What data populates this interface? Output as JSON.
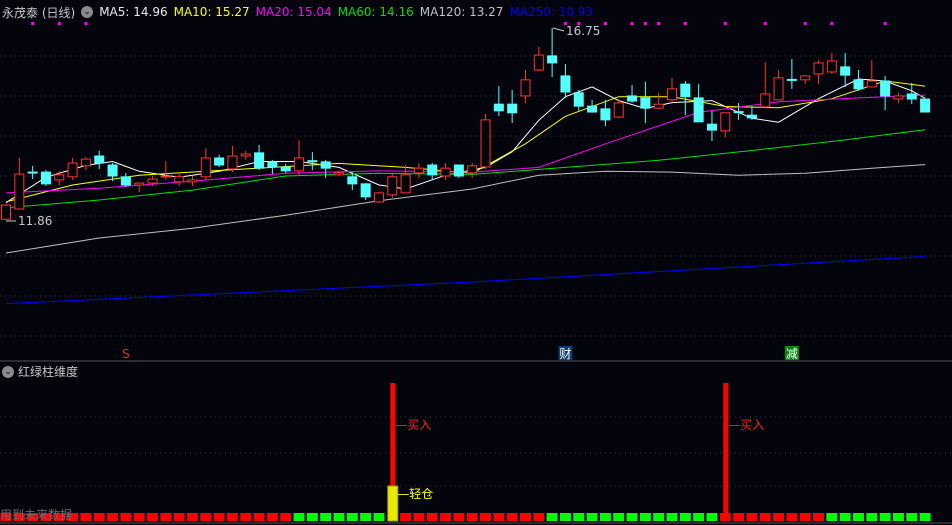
{
  "header": {
    "stock_title": "永茂泰 (日线)",
    "ma": [
      {
        "label": "MA5: 14.96",
        "color": "#e8e8e8"
      },
      {
        "label": "MA10: 15.27",
        "color": "#ffff00"
      },
      {
        "label": "MA20: 15.04",
        "color": "#ff00ff"
      },
      {
        "label": "MA60: 14.16",
        "color": "#00e000"
      },
      {
        "label": "MA120: 13.27",
        "color": "#c0c0c0"
      },
      {
        "label": "MA250: 10.93",
        "color": "#0000ff"
      }
    ]
  },
  "indicator_panel": {
    "title": "红绿柱维度",
    "buy_label": "买入",
    "light_label": "轻仓",
    "watermark": "用到未来数据"
  },
  "chart_data": {
    "type": "candlestick",
    "high_label": "16.75",
    "low_label": "11.86",
    "colors": {
      "up": "#ff3232",
      "down": "#54ffff"
    },
    "candles": [
      [
        11.88,
        12.26,
        11.86,
        12.24
      ],
      [
        12.14,
        13.44,
        12.12,
        13.03
      ],
      [
        13.08,
        13.24,
        12.9,
        13.06
      ],
      [
        13.08,
        13.13,
        12.73,
        12.78
      ],
      [
        12.88,
        13.11,
        12.75,
        13.01
      ],
      [
        12.96,
        13.44,
        12.88,
        13.31
      ],
      [
        13.24,
        13.46,
        13.13,
        13.41
      ],
      [
        13.49,
        13.62,
        13.16,
        13.31
      ],
      [
        13.26,
        13.31,
        12.85,
        12.98
      ],
      [
        12.96,
        13.06,
        12.7,
        12.75
      ],
      [
        12.75,
        12.8,
        12.57,
        12.8
      ],
      [
        12.8,
        12.98,
        12.73,
        12.9
      ],
      [
        12.97,
        13.36,
        12.88,
        12.98
      ],
      [
        12.83,
        13.06,
        12.73,
        12.96
      ],
      [
        12.83,
        12.98,
        12.73,
        12.88
      ],
      [
        12.96,
        13.69,
        12.88,
        13.44
      ],
      [
        13.44,
        13.52,
        13.21,
        13.26
      ],
      [
        13.16,
        13.75,
        13.08,
        13.49
      ],
      [
        13.49,
        13.62,
        13.39,
        13.54
      ],
      [
        13.57,
        13.77,
        13.13,
        13.18
      ],
      [
        13.34,
        13.39,
        13.03,
        13.21
      ],
      [
        13.21,
        13.29,
        13.06,
        13.11
      ],
      [
        13.11,
        13.9,
        13.01,
        13.44
      ],
      [
        13.37,
        13.59,
        13.13,
        13.35
      ],
      [
        13.34,
        13.39,
        12.93,
        13.18
      ],
      [
        13.01,
        13.13,
        12.98,
        13.06
      ],
      [
        12.96,
        13.08,
        12.62,
        12.78
      ],
      [
        12.78,
        12.8,
        12.37,
        12.45
      ],
      [
        12.32,
        12.57,
        12.29,
        12.55
      ],
      [
        12.5,
        13.03,
        12.42,
        12.96
      ],
      [
        12.55,
        13.26,
        12.55,
        13.01
      ],
      [
        13.06,
        13.31,
        12.93,
        13.18
      ],
      [
        13.26,
        13.31,
        12.88,
        13.01
      ],
      [
        12.98,
        13.31,
        12.88,
        13.18
      ],
      [
        13.26,
        13.26,
        12.93,
        12.98
      ],
      [
        13.06,
        13.31,
        12.93,
        13.24
      ],
      [
        13.21,
        14.56,
        13.16,
        14.41
      ],
      [
        14.81,
        15.27,
        14.51,
        14.64
      ],
      [
        14.81,
        15.17,
        14.33,
        14.59
      ],
      [
        15.02,
        15.68,
        14.84,
        15.43
      ],
      [
        15.68,
        16.27,
        15.65,
        16.06
      ],
      [
        16.04,
        16.75,
        15.5,
        15.86
      ],
      [
        15.53,
        15.83,
        14.97,
        15.12
      ],
      [
        15.1,
        15.17,
        14.64,
        14.76
      ],
      [
        14.76,
        14.92,
        14.59,
        14.61
      ],
      [
        14.69,
        14.92,
        14.25,
        14.41
      ],
      [
        14.48,
        14.94,
        14.46,
        14.84
      ],
      [
        15.02,
        15.3,
        14.84,
        14.89
      ],
      [
        14.97,
        15.38,
        14.33,
        14.71
      ],
      [
        14.71,
        15.1,
        14.69,
        14.81
      ],
      [
        14.92,
        15.48,
        14.89,
        15.2
      ],
      [
        15.32,
        15.4,
        14.53,
        15.0
      ],
      [
        14.97,
        15.32,
        14.36,
        14.36
      ],
      [
        14.3,
        14.64,
        13.87,
        14.15
      ],
      [
        14.13,
        14.59,
        13.97,
        14.59
      ],
      [
        14.62,
        14.84,
        14.41,
        14.6
      ],
      [
        14.53,
        14.76,
        14.41,
        14.46
      ],
      [
        14.74,
        15.88,
        14.71,
        15.07
      ],
      [
        14.92,
        15.68,
        14.92,
        15.48
      ],
      [
        15.44,
        15.96,
        15.2,
        15.42
      ],
      [
        15.43,
        15.55,
        15.32,
        15.53
      ],
      [
        15.58,
        15.93,
        15.32,
        15.86
      ],
      [
        15.63,
        16.11,
        15.58,
        15.91
      ],
      [
        15.76,
        16.11,
        15.25,
        15.55
      ],
      [
        15.43,
        15.68,
        15.15,
        15.2
      ],
      [
        15.25,
        15.93,
        15.25,
        15.4
      ],
      [
        15.4,
        15.53,
        14.66,
        15.02
      ],
      [
        14.94,
        15.1,
        14.84,
        15.02
      ],
      [
        15.07,
        15.35,
        14.81,
        14.94
      ],
      [
        14.94,
        14.94,
        14.61,
        14.61
      ]
    ],
    "ma_series": [
      {
        "name": "MA5",
        "color": "#ffffff",
        "points": [
          [
            0,
            12.3
          ],
          [
            3,
            12.95
          ],
          [
            6,
            13.25
          ],
          [
            8,
            13.35
          ],
          [
            10,
            13.1
          ],
          [
            13,
            12.95
          ],
          [
            16,
            13.1
          ],
          [
            19,
            13.35
          ],
          [
            22,
            13.35
          ],
          [
            25,
            13.2
          ],
          [
            28,
            12.75
          ],
          [
            30,
            12.65
          ],
          [
            33,
            13.0
          ],
          [
            36,
            13.2
          ],
          [
            38,
            13.6
          ],
          [
            40,
            14.4
          ],
          [
            42,
            15.0
          ],
          [
            44,
            15.25
          ],
          [
            46,
            14.9
          ],
          [
            48,
            14.7
          ],
          [
            50,
            14.85
          ],
          [
            53,
            14.9
          ],
          [
            56,
            14.45
          ],
          [
            58,
            14.35
          ],
          [
            61,
            14.95
          ],
          [
            64,
            15.45
          ],
          [
            66,
            15.4
          ],
          [
            68,
            15.15
          ],
          [
            69,
            14.96
          ]
        ]
      },
      {
        "name": "MA10",
        "color": "#ffff00",
        "points": [
          [
            0,
            12.32
          ],
          [
            5,
            12.75
          ],
          [
            10,
            13.0
          ],
          [
            15,
            13.1
          ],
          [
            20,
            13.2
          ],
          [
            25,
            13.3
          ],
          [
            30,
            13.2
          ],
          [
            35,
            13.05
          ],
          [
            39,
            13.8
          ],
          [
            42,
            14.5
          ],
          [
            46,
            15.0
          ],
          [
            50,
            15.0
          ],
          [
            54,
            14.75
          ],
          [
            58,
            14.72
          ],
          [
            62,
            14.95
          ],
          [
            66,
            15.4
          ],
          [
            69,
            15.27
          ]
        ]
      },
      {
        "name": "MA20",
        "color": "#ff00ff",
        "points": [
          [
            0,
            12.55
          ],
          [
            7,
            12.67
          ],
          [
            14,
            12.85
          ],
          [
            21,
            13.05
          ],
          [
            28,
            13.11
          ],
          [
            35,
            13.08
          ],
          [
            40,
            13.2
          ],
          [
            45,
            13.8
          ],
          [
            52,
            14.6
          ],
          [
            58,
            14.87
          ],
          [
            64,
            14.97
          ],
          [
            69,
            15.04
          ]
        ]
      },
      {
        "name": "MA60",
        "color": "#00e000",
        "points": [
          [
            0,
            12.17
          ],
          [
            7,
            12.37
          ],
          [
            14,
            12.62
          ],
          [
            21,
            12.98
          ],
          [
            28,
            13.05
          ],
          [
            35,
            13.02
          ],
          [
            42,
            13.2
          ],
          [
            49,
            13.38
          ],
          [
            56,
            13.63
          ],
          [
            63,
            13.9
          ],
          [
            69,
            14.16
          ]
        ]
      },
      {
        "name": "MA120",
        "color": "#c0c0c0",
        "points": [
          [
            0,
            11.02
          ],
          [
            7,
            11.4
          ],
          [
            14,
            11.65
          ],
          [
            21,
            11.98
          ],
          [
            28,
            12.35
          ],
          [
            35,
            12.65
          ],
          [
            40,
            13.0
          ],
          [
            45,
            13.1
          ],
          [
            50,
            13.08
          ],
          [
            55,
            13.0
          ],
          [
            60,
            13.05
          ],
          [
            65,
            13.18
          ],
          [
            69,
            13.27
          ]
        ]
      },
      {
        "name": "MA250",
        "color": "#0000ff",
        "points": [
          [
            0,
            9.73
          ],
          [
            35,
            10.28
          ],
          [
            69,
            10.93
          ]
        ]
      }
    ],
    "signal_dots": [
      2,
      4,
      6,
      42,
      43,
      45,
      47,
      48,
      49,
      51,
      54,
      57,
      60,
      62,
      66
    ],
    "event_markers": [
      {
        "index": 9,
        "text": "S",
        "bg": "none",
        "color": "#ff2020"
      },
      {
        "index": 42,
        "text": "财",
        "bg": "#103c6c",
        "color": "#ffffff"
      },
      {
        "index": 59,
        "text": "减",
        "bg": "#0a8a0a",
        "color": "#ffffff"
      }
    ],
    "indicator": {
      "bar_colors": "RRRRRRRRRRRRRRRRRRRRRRGGGGGGGYRRRRRRRRRRRGGGGGGGGGGGGGRRRRRRRRGGGGGGGG",
      "buy_signals": [
        29,
        54
      ],
      "light_position": [
        29
      ]
    }
  }
}
